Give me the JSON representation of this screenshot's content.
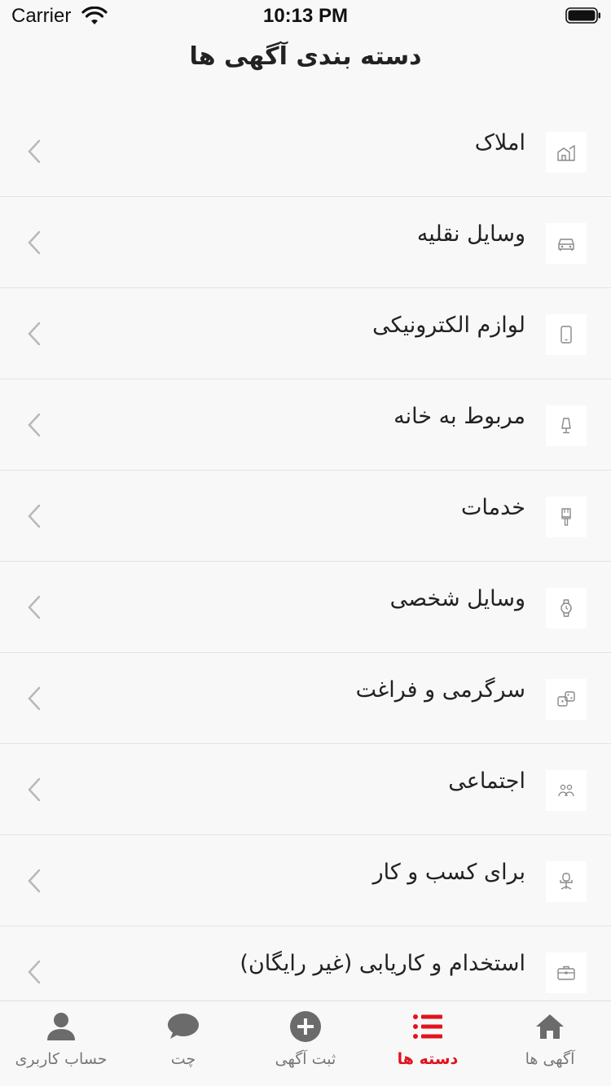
{
  "status_bar": {
    "carrier": "Carrier",
    "time": "10:13 PM"
  },
  "page_title": "دسته بندی آگهی ها",
  "categories": [
    {
      "label": "املاک",
      "icon": "house-icon"
    },
    {
      "label": "وسایل نقلیه",
      "icon": "car-icon"
    },
    {
      "label": "لوازم الکترونیکی",
      "icon": "phone-icon"
    },
    {
      "label": "مربوط به خانه",
      "icon": "lamp-icon"
    },
    {
      "label": "خدمات",
      "icon": "paint-brush-icon"
    },
    {
      "label": "وسایل شخصی",
      "icon": "watch-icon"
    },
    {
      "label": "سرگرمی و فراغت",
      "icon": "dice-icon"
    },
    {
      "label": "اجتماعی",
      "icon": "people-icon"
    },
    {
      "label": "برای کسب و کار",
      "icon": "office-chair-icon"
    },
    {
      "label": "استخدام و کاریابی (غیر رایگان)",
      "icon": "briefcase-icon"
    }
  ],
  "tabbar": {
    "tabs": [
      {
        "label": "آگهی ها",
        "icon": "home-icon",
        "active": false
      },
      {
        "label": "دسته ها",
        "icon": "list-icon",
        "active": true
      },
      {
        "label": "ثبت آگهی",
        "icon": "plus-circle-icon",
        "active": false
      },
      {
        "label": "چت",
        "icon": "chat-bubble-icon",
        "active": false
      },
      {
        "label": "حساب کاربری",
        "icon": "user-icon",
        "active": false
      }
    ]
  },
  "colors": {
    "accent": "#e0141e",
    "inactive": "#777777",
    "background": "#f8f8f8"
  }
}
